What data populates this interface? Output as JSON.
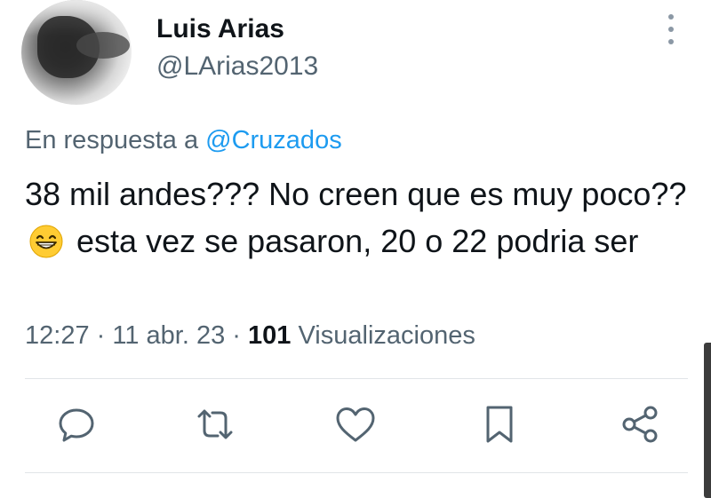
{
  "author": {
    "name": "Luis Arias",
    "handle": "@LArias2013"
  },
  "reply_context": {
    "prefix": "En respuesta a",
    "mention": "@Cruzados"
  },
  "tweet": {
    "text_part1": "38 mil andes??? No creen que es muy poco??",
    "emoji": "grinning-face-with-smiling-eyes",
    "text_part2": "esta vez se pasaron, 20 o 22 podria ser"
  },
  "meta": {
    "time": "12:27",
    "date": "11 abr. 23",
    "separator": "·",
    "views_count": "101",
    "views_label": "Visualizaciones"
  },
  "actions": [
    {
      "name": "reply",
      "icon": "reply-icon"
    },
    {
      "name": "retweet",
      "icon": "retweet-icon"
    },
    {
      "name": "like",
      "icon": "heart-icon"
    },
    {
      "name": "bookmark",
      "icon": "bookmark-icon"
    },
    {
      "name": "share",
      "icon": "share-icon"
    }
  ],
  "colors": {
    "text": "#0f1419",
    "secondary": "#536471",
    "link": "#1d9bf0",
    "icon": "#536471"
  }
}
